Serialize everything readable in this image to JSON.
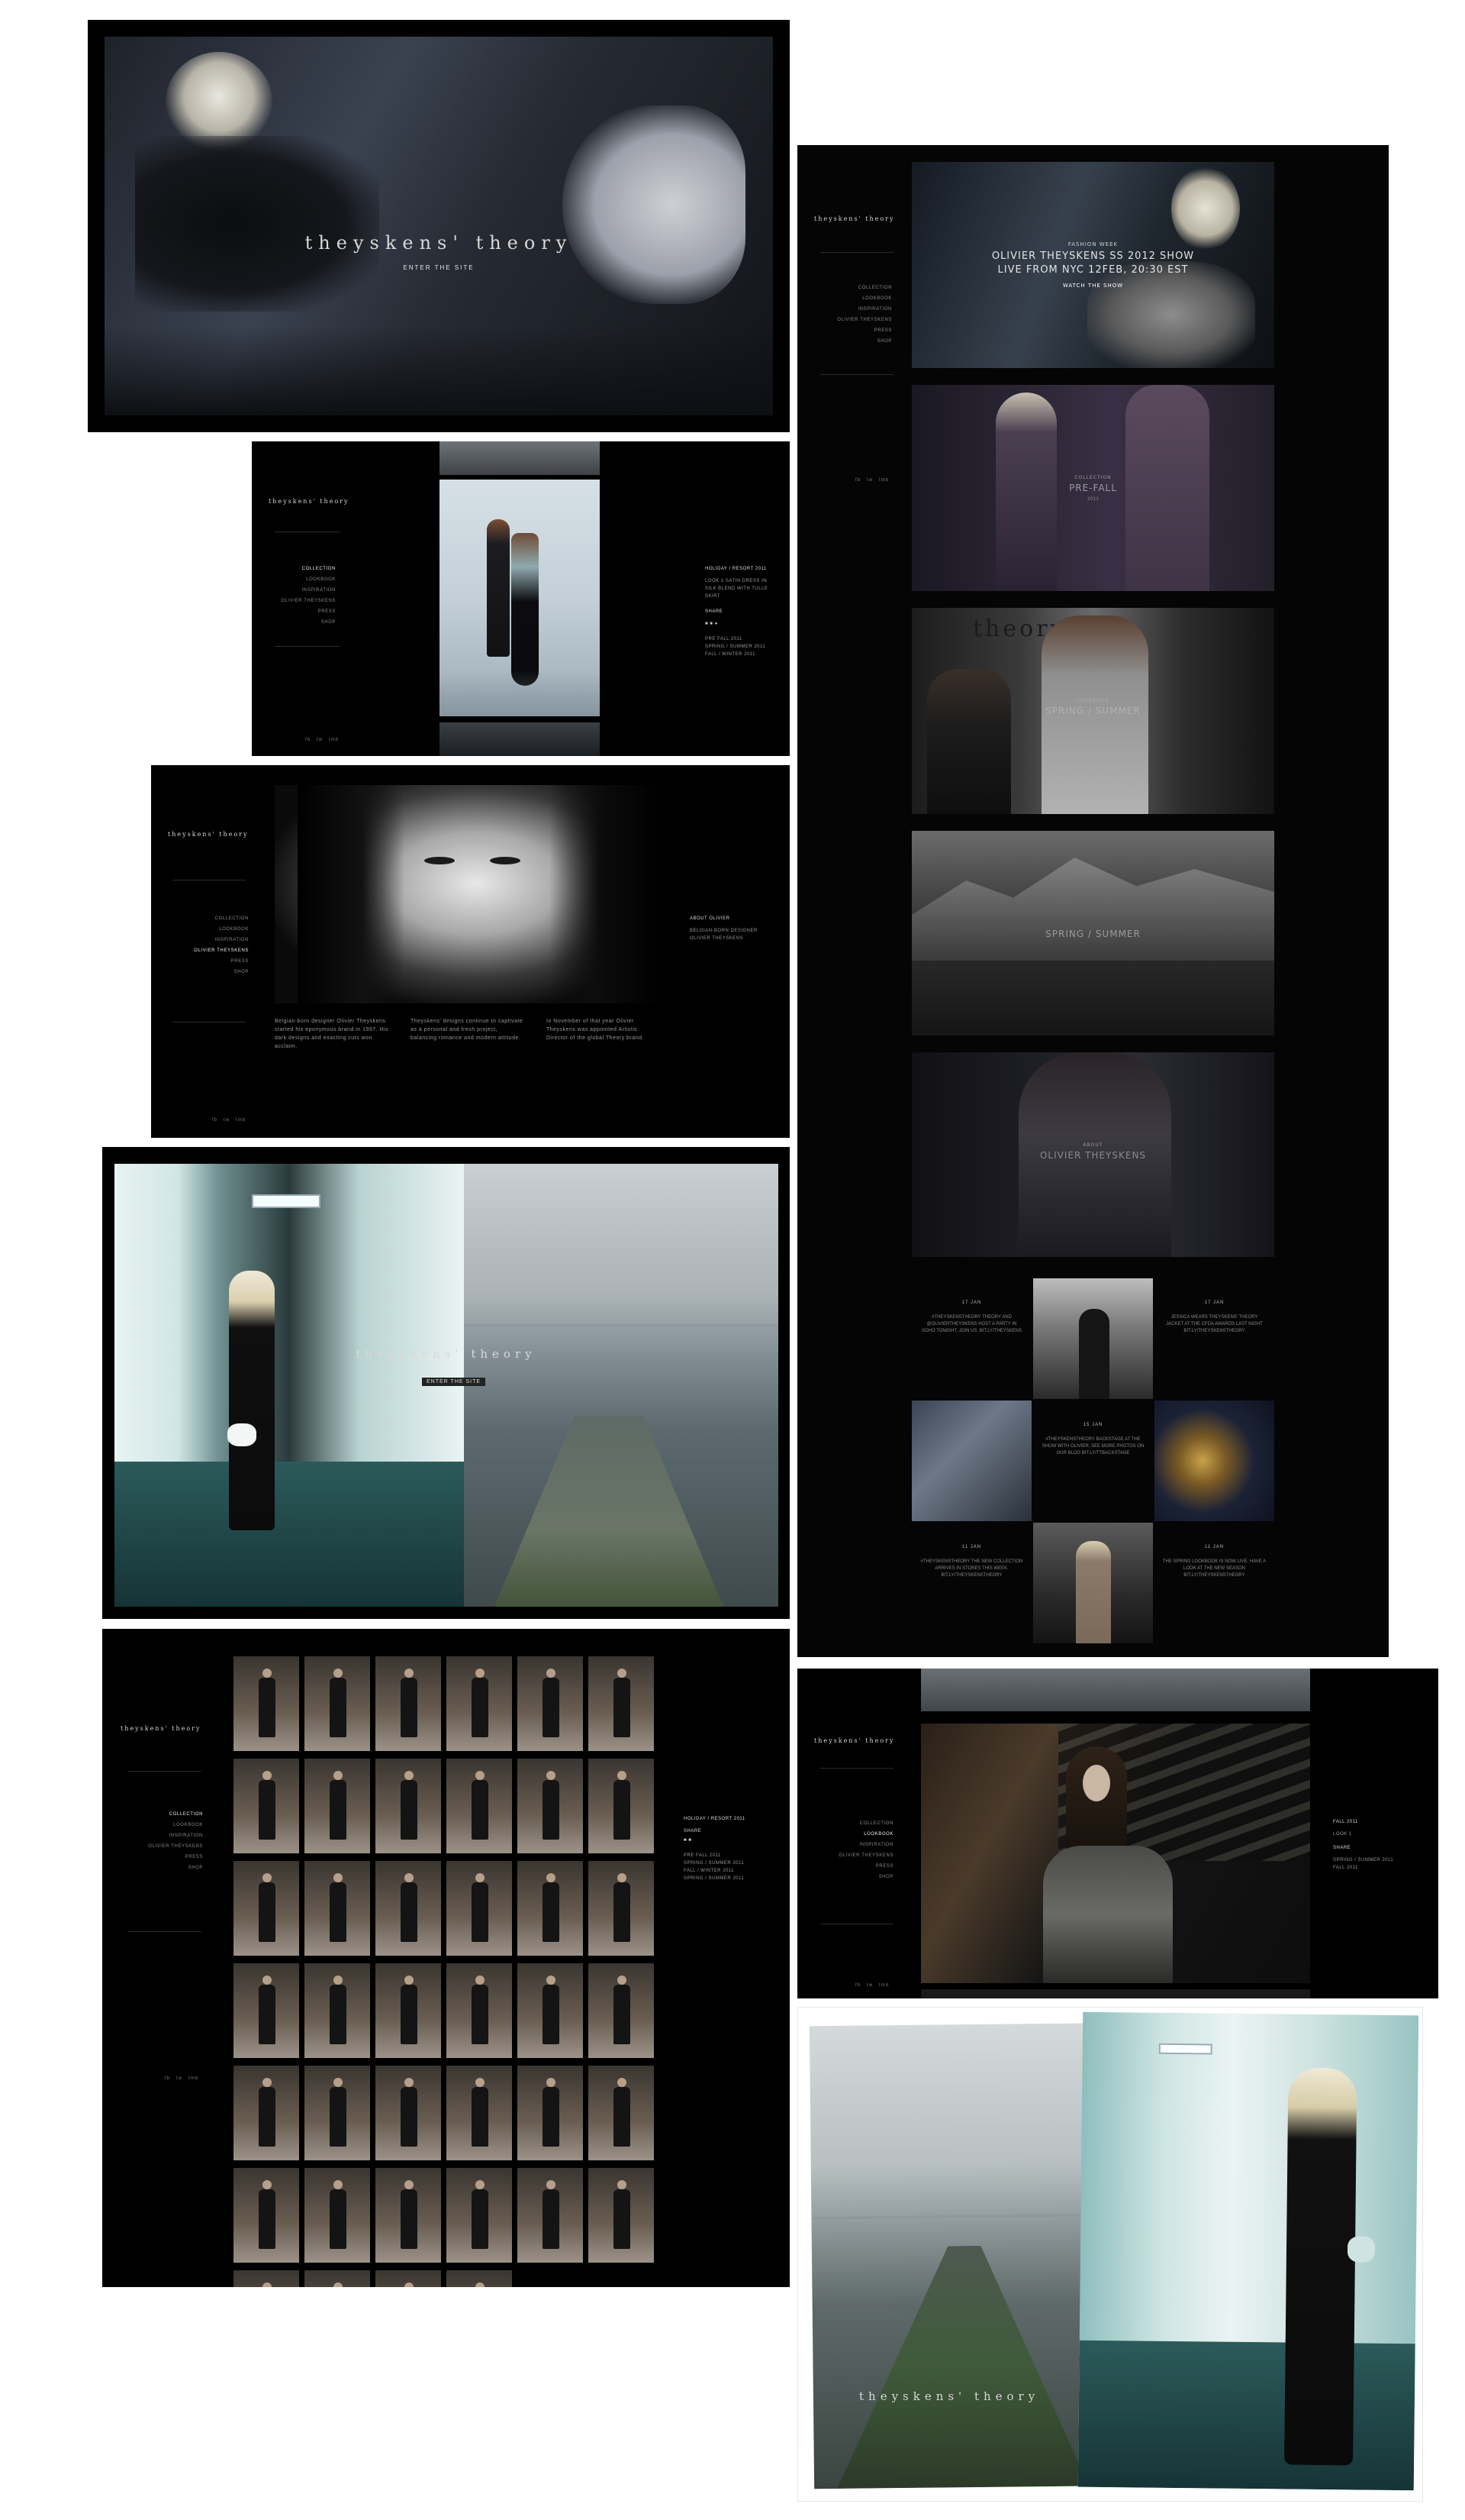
{
  "brand": {
    "logo": "theyskens' theory"
  },
  "splash": {
    "enter_label": "ENTER THE SITE"
  },
  "home": {
    "nav": [
      "COLLECTION",
      "LOOKBOOK",
      "INSPIRATION",
      "OLIVIER THEYSKENS",
      "PRESS",
      "SHOP"
    ],
    "social": [
      "fb",
      "tw",
      "tmb"
    ],
    "hero": {
      "kicker": "FASHION WEEK",
      "title_line1": "OLIVIER THEYSKENS SS 2012 SHOW",
      "title_line2": "LIVE FROM NYC 12FEB, 20:30 EST",
      "cta": "WATCH THE SHOW"
    },
    "sections": [
      {
        "kicker": "COLLECTION",
        "title": "PRE-FALL",
        "sub": "2011"
      },
      {
        "kicker": "LOOKBOOK",
        "title": "SPRING / SUMMER",
        "sub": "2011"
      },
      {
        "kicker": "",
        "title": "SPRING / SUMMER",
        "sub": ""
      },
      {
        "kicker": "ABOUT",
        "title": "OLIVIER THEYSKENS",
        "sub": ""
      }
    ],
    "tweets": [
      {
        "time": "17 JAN",
        "text": "#THEYSKENSTHEORY THEORY AND @OLIVIERTHEYSKENS HOST A PARTY IN SOHO TONIGHT. JOIN US. BIT.LY/THEYSKENS"
      },
      {
        "time": "17 JAN",
        "text": "JESSICA WEARS THEYSKENS' THEORY JACKET AT THE CFDA AWARDS LAST NIGHT BIT.LY/THEYSKENSTHEORY"
      },
      {
        "time": "15 JAN",
        "text": "#THEYSKENSTHEORY BACKSTAGE AT THE SHOW WITH OLIVIER. SEE MORE PHOTOS ON OUR BLOG BIT.LY/TTBACKSTAGE"
      },
      {
        "time": "11 JAN",
        "text": "#THEYSKENSTHEORY THE NEW COLLECTION ARRIVES IN STORES THIS WEEK. BIT.LY/THEYSKENSTHEORY"
      },
      {
        "time": "11 JAN",
        "text": "THE SPRING LOOKBOOK IS NOW LIVE. HAVE A LOOK AT THE NEW SEASON BIT.LY/THEYSKENSTHEORY"
      }
    ]
  },
  "collection": {
    "nav": [
      "COLLECTION",
      "LOOKBOOK",
      "INSPIRATION",
      "OLIVIER THEYSKENS",
      "PRESS",
      "SHOP"
    ],
    "social": [
      "fb",
      "tw",
      "tmb"
    ],
    "info_title": "HOLIDAY / RESORT 2011",
    "info_text": "LOOK 1 SATIN DRESS IN SILK BLEND WITH TULLE SKIRT",
    "share_label": "SHARE",
    "list": [
      "PRE FALL 2011",
      "SPRING / SUMMER 2011",
      "FALL / WINTER 2011"
    ]
  },
  "about": {
    "nav": [
      "COLLECTION",
      "LOOKBOOK",
      "INSPIRATION",
      "OLIVIER THEYSKENS",
      "PRESS",
      "SHOP"
    ],
    "side_title": "ABOUT OLIVIER",
    "side_text": "BELGIAN-BORN DESIGNER OLIVIER THEYSKENS",
    "col1": "Belgian-born designer Olivier Theyskens started his eponymous brand in 1997. His dark designs and exacting cuts won acclaim.",
    "col2": "Theyskens' designs continue to captivate as a personal and fresh project, balancing romance and modern attitude.",
    "col3": "In November of that year Olivier Theyskens was appointed Artistic Director of the global Theory brand."
  },
  "lookbook": {
    "nav": [
      "COLLECTION",
      "LOOKBOOK",
      "INSPIRATION",
      "OLIVIER THEYSKENS",
      "PRESS",
      "SHOP"
    ],
    "side_title": "FALL 2011",
    "side_text": "LOOK 1",
    "share_label": "SHARE",
    "list": [
      "SPRING / SUMMER 2011",
      "FALL 2011"
    ]
  },
  "grid": {
    "nav": [
      "COLLECTION",
      "LOOKBOOK",
      "INSPIRATION",
      "OLIVIER THEYSKENS",
      "PRESS",
      "SHOP"
    ],
    "side_title": "HOLIDAY / RESORT 2011",
    "share_label": "SHARE",
    "list": [
      "PRE FALL 2011",
      "SPRING / SUMMER 2011",
      "FALL / WINTER 2011",
      "SPRING / SUMMER 2011"
    ],
    "looks_count": 40
  },
  "entry": {
    "enter_label": "ENTER THE SITE"
  }
}
